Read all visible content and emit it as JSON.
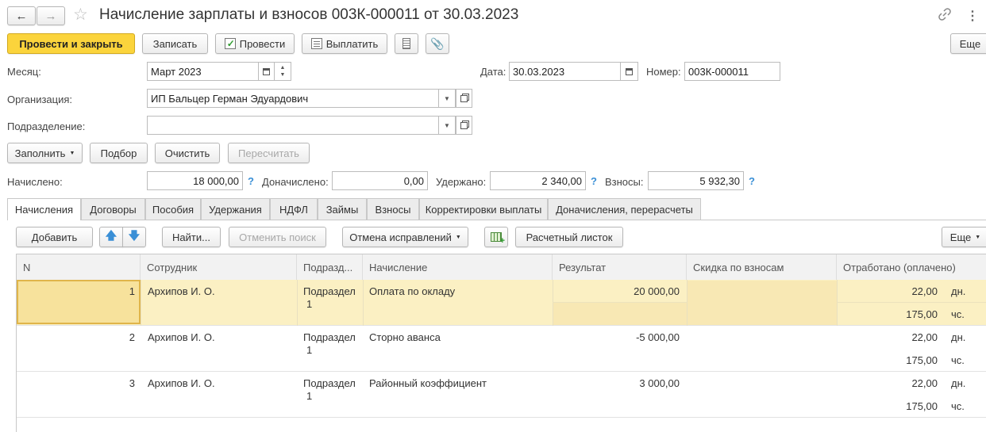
{
  "window": {
    "title": "Начисление зарплаты и взносов 003К-000011 от 30.03.2023"
  },
  "icons": {
    "back": "arrow-left-icon",
    "forward": "arrow-right-icon",
    "favorite": "star-icon",
    "link": "link-icon",
    "menu": "more-vertical-icon"
  },
  "toolbar": {
    "post_close": "Провести и закрыть",
    "write": "Записать",
    "post": "Провести",
    "pay": "Выплатить",
    "more": "Еще"
  },
  "form": {
    "month_label": "Месяц:",
    "month_value": "Март 2023",
    "date_label": "Дата:",
    "date_value": "30.03.2023",
    "number_label": "Номер:",
    "number_value": "003К-000011",
    "org_label": "Организация:",
    "org_value": "ИП Бальцер Герман Эдуардович",
    "dept_label": "Подразделение:",
    "dept_value": ""
  },
  "actions": {
    "fill": "Заполнить",
    "select": "Подбор",
    "clear": "Очистить",
    "recalc": "Пересчитать"
  },
  "totals": {
    "accrued_label": "Начислено:",
    "accrued_value": "18 000,00",
    "extra_label": "Доначислено:",
    "extra_value": "0,00",
    "withheld_label": "Удержано:",
    "withheld_value": "2 340,00",
    "contrib_label": "Взносы:",
    "contrib_value": "5 932,30",
    "help": "?"
  },
  "tabs": [
    "Начисления",
    "Договоры",
    "Пособия",
    "Удержания",
    "НДФЛ",
    "Займы",
    "Взносы",
    "Корректировки выплаты",
    "Доначисления, перерасчеты"
  ],
  "table_toolbar": {
    "add": "Добавить",
    "find": "Найти...",
    "cancel_search": "Отменить поиск",
    "undo_fixes": "Отмена исправлений",
    "payslip": "Расчетный листок",
    "more": "Еще"
  },
  "columns": [
    "N",
    "Сотрудник",
    "Подразд...",
    "Начисление",
    "Результат",
    "Скидка по взносам",
    "Отработано (оплачено)"
  ],
  "rows": [
    {
      "n": "1",
      "employee": "Архипов И. О.",
      "dept_line1": "Подраздел",
      "dept_line2": "1",
      "accrual": "Оплата по окладу",
      "result": "20 000,00",
      "discount": "",
      "days": "22,00",
      "days_unit": "дн.",
      "hours": "175,00",
      "hours_unit": "чс."
    },
    {
      "n": "2",
      "employee": "Архипов И. О.",
      "dept_line1": "Подраздел",
      "dept_line2": "1",
      "accrual": "Сторно аванса",
      "result": "-5 000,00",
      "discount": "",
      "days": "22,00",
      "days_unit": "дн.",
      "hours": "175,00",
      "hours_unit": "чс."
    },
    {
      "n": "3",
      "employee": "Архипов И. О.",
      "dept_line1": "Подраздел",
      "dept_line2": "1",
      "accrual": "Районный коэффициент",
      "result": "3 000,00",
      "discount": "",
      "days": "22,00",
      "days_unit": "дн.",
      "hours": "175,00",
      "hours_unit": "чс."
    }
  ],
  "colors": {
    "primary": "#fbd43c",
    "selected_row": "#fbf0c3",
    "help": "#3a8fd6"
  }
}
